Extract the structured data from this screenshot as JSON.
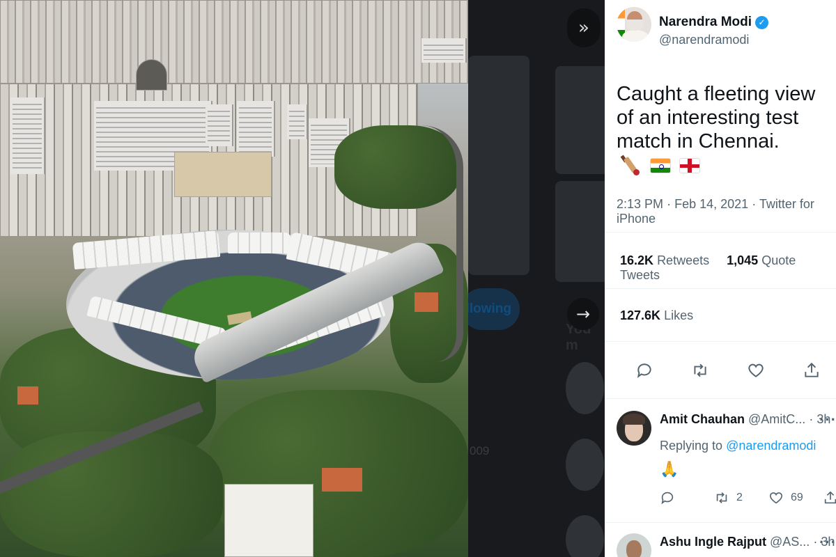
{
  "viewer": {
    "controls": {
      "collapse_icon": "double-chevron-right-icon",
      "collapse_glyph": "»",
      "next_icon": "arrow-right-icon",
      "next_glyph": "→",
      "following_label": "llowing",
      "year_fragment": "009",
      "heading_fragment": "You m"
    }
  },
  "tweet": {
    "author": {
      "name": "Narendra Modi",
      "handle": "@narendramodi",
      "verified_glyph": "✓"
    },
    "text": "Caught a fleeting view of an interesting test match in Chennai.",
    "emojis": [
      "cricket-bat-icon",
      "india-flag-icon",
      "england-flag-icon"
    ],
    "time": "2:13 PM",
    "date": "Feb 14, 2021",
    "separator": "·",
    "source": "Twitter for iPhone",
    "stats": {
      "retweets_count": "16.2K",
      "retweets_label": "Retweets",
      "quotes_count": "1,045",
      "quotes_label": "Quote Tweets",
      "likes_count": "127.6K",
      "likes_label": "Likes"
    },
    "actions": [
      "reply-icon",
      "retweet-icon",
      "like-icon",
      "share-icon"
    ]
  },
  "replies": [
    {
      "name": "Amit Chauhan",
      "handle": "@AmitC...",
      "separator": "·",
      "time": "3h",
      "more": "···",
      "replying_prefix": "Replying to",
      "replying_to": "@narendramodi",
      "body_emoji": "🙏",
      "retweet_count": "2",
      "like_count": "69"
    },
    {
      "name": "Ashu Ingle Rajput",
      "handle": "@AS...",
      "separator": "·",
      "time": "3h",
      "more": "···"
    }
  ],
  "colors": {
    "accent": "#1d9bf0",
    "text_primary": "#0f1419",
    "text_secondary": "#536471",
    "panel_bg": "#ffffff",
    "overlay_bg": "#181a1d"
  }
}
